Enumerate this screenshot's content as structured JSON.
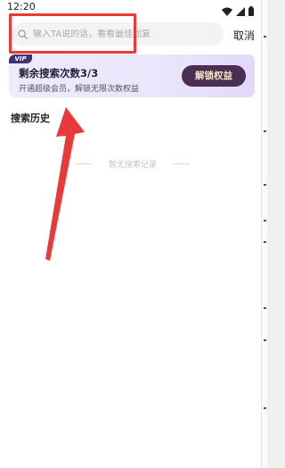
{
  "status_bar": {
    "time": "12:20",
    "icons": [
      "wifi-icon",
      "signal-icon",
      "battery-icon"
    ]
  },
  "search": {
    "placeholder": "输入TA说的话，看看最佳回复",
    "value": "",
    "cancel_label": "取消"
  },
  "vip_banner": {
    "tag": "VIP",
    "title": "剩余搜索次数3/3",
    "subtitle": "开通超级会员，解锁无限次数权益",
    "unlock_label": "解锁权益"
  },
  "history": {
    "title": "搜索历史",
    "empty_text": "暂无搜索记录"
  },
  "colors": {
    "annotation": "#e83a3a",
    "unlock_button_bg": "#4a2f52",
    "unlock_button_text": "#f7e3c8",
    "vip_tag_bg": "#3d3474"
  }
}
